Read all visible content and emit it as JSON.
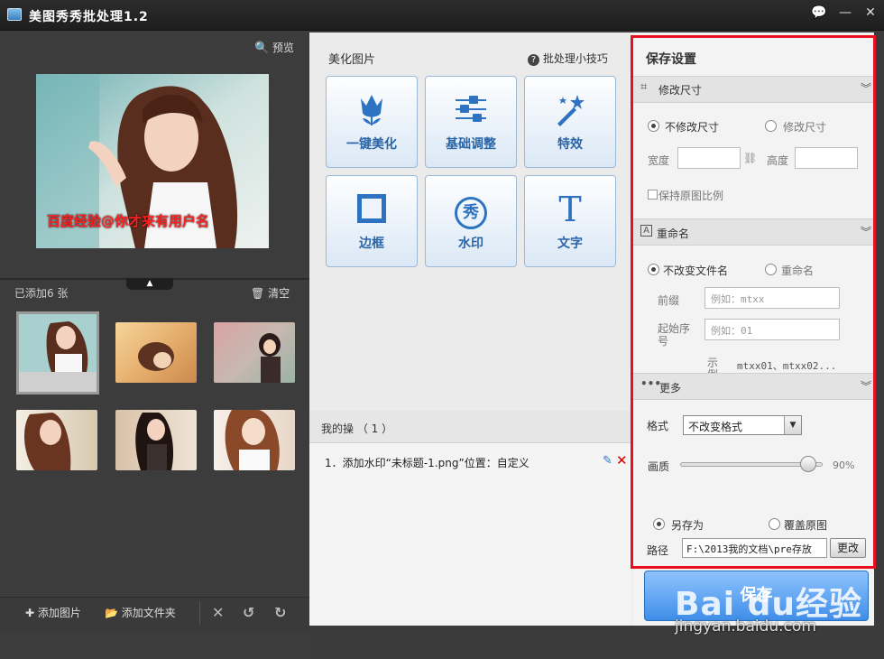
{
  "window": {
    "title": "美图秀秀批处理1.2",
    "controls": [
      "💬",
      "—",
      "✕"
    ]
  },
  "left": {
    "preview_label": "预览",
    "watermark_text": "百度经验@你才来有用户名",
    "added_count": "已添加6 张",
    "clear_label": "清空",
    "bottom": {
      "add_image": "添加图片",
      "add_folder": "添加文件夹"
    }
  },
  "center": {
    "title": "美化图片",
    "tips": "批处理小技巧",
    "tools": [
      {
        "label": "一键美化",
        "icon": "tulip-icon"
      },
      {
        "label": "基础调整",
        "icon": "sliders-icon"
      },
      {
        "label": "特效",
        "icon": "magic-wand-icon"
      },
      {
        "label": "边框",
        "icon": "frame-icon"
      },
      {
        "label": "水印",
        "icon": "watermark-seal-icon",
        "glyph": "秀"
      },
      {
        "label": "文字",
        "icon": "text-icon",
        "glyph": "T"
      }
    ],
    "ops_title": "我的操  （ 1 ）",
    "ops_item": "1．添加水印“未标题-1.png”位置：自定义"
  },
  "right": {
    "title": "保存设置",
    "resize": {
      "header": "修改尺寸",
      "opt_keep": "不修改尺寸",
      "opt_change": "修改尺寸",
      "width_label": "宽度",
      "height_label": "高度",
      "keep_ratio": "保持原图比例"
    },
    "rename": {
      "header": "重命名",
      "opt_keep": "不改变文件名",
      "opt_rename": "重命名",
      "prefix_label": "前缀",
      "prefix_placeholder": "例如：mtxx",
      "start_label": "起始序号",
      "start_placeholder": "例如：01",
      "example_label": "示例",
      "example_value": "mtxx01、mtxx02..."
    },
    "more": {
      "header": "更多",
      "format_label": "格式",
      "format_value": "不改变格式",
      "quality_label": "画质",
      "quality_value": "90%",
      "quality": 0.9,
      "opt_saveas": "另存为",
      "opt_overwrite": "覆盖原图",
      "path_label": "路径",
      "path_value": "F:\\2013我的文档\\pre存放",
      "change_label": "更改"
    },
    "save_label": "保存"
  },
  "overlay": {
    "baidu_logo": "Bai du经验",
    "baidu_url": "jingyan.baidu.com"
  },
  "colors": {
    "accent_blue": "#2e73c2",
    "highlight_red": "#e8101f",
    "dark_bg": "#3c3c3c"
  }
}
